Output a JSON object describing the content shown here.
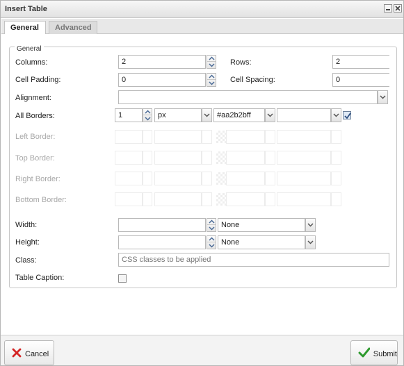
{
  "dialog": {
    "title": "Insert Table",
    "tabs": [
      {
        "label": "General",
        "active": true
      },
      {
        "label": "Advanced",
        "active": false
      }
    ]
  },
  "general": {
    "legend": "General",
    "columns": {
      "label": "Columns:",
      "value": "2"
    },
    "rows": {
      "label": "Rows:",
      "value": "2"
    },
    "cell_padding": {
      "label": "Cell Padding:",
      "value": "0"
    },
    "cell_spacing": {
      "label": "Cell Spacing:",
      "value": "0"
    },
    "alignment": {
      "label": "Alignment:",
      "value": ""
    },
    "all_borders": {
      "label": "All Borders:",
      "width": "1",
      "unit": "px",
      "color": "#aa2b2bff",
      "style": "",
      "checked": true
    },
    "left_border": {
      "label": "Left Border:"
    },
    "top_border": {
      "label": "Top Border:"
    },
    "right_border": {
      "label": "Right Border:"
    },
    "bottom_border": {
      "label": "Bottom Border:"
    },
    "width": {
      "label": "Width:",
      "value": "",
      "unit": "None"
    },
    "height": {
      "label": "Height:",
      "value": "",
      "unit": "None"
    },
    "class": {
      "label": "Class:",
      "placeholder": "CSS classes to be applied"
    },
    "table_caption": {
      "label": "Table Caption:",
      "checked": false
    }
  },
  "footer": {
    "cancel_label": "Cancel",
    "submit_label": "Submit"
  },
  "colors": {
    "cancel_icon": "#d42424",
    "submit_icon": "#2e9a2e",
    "checkbox_check": "#2d4f80"
  },
  "icons": {
    "minimize": "minimize-icon",
    "close": "close-icon",
    "spin_up": "chevron-up-icon",
    "spin_down": "chevron-down-icon",
    "dropdown": "chevron-down-icon",
    "cancel": "x-mark-icon",
    "submit": "check-mark-icon"
  }
}
